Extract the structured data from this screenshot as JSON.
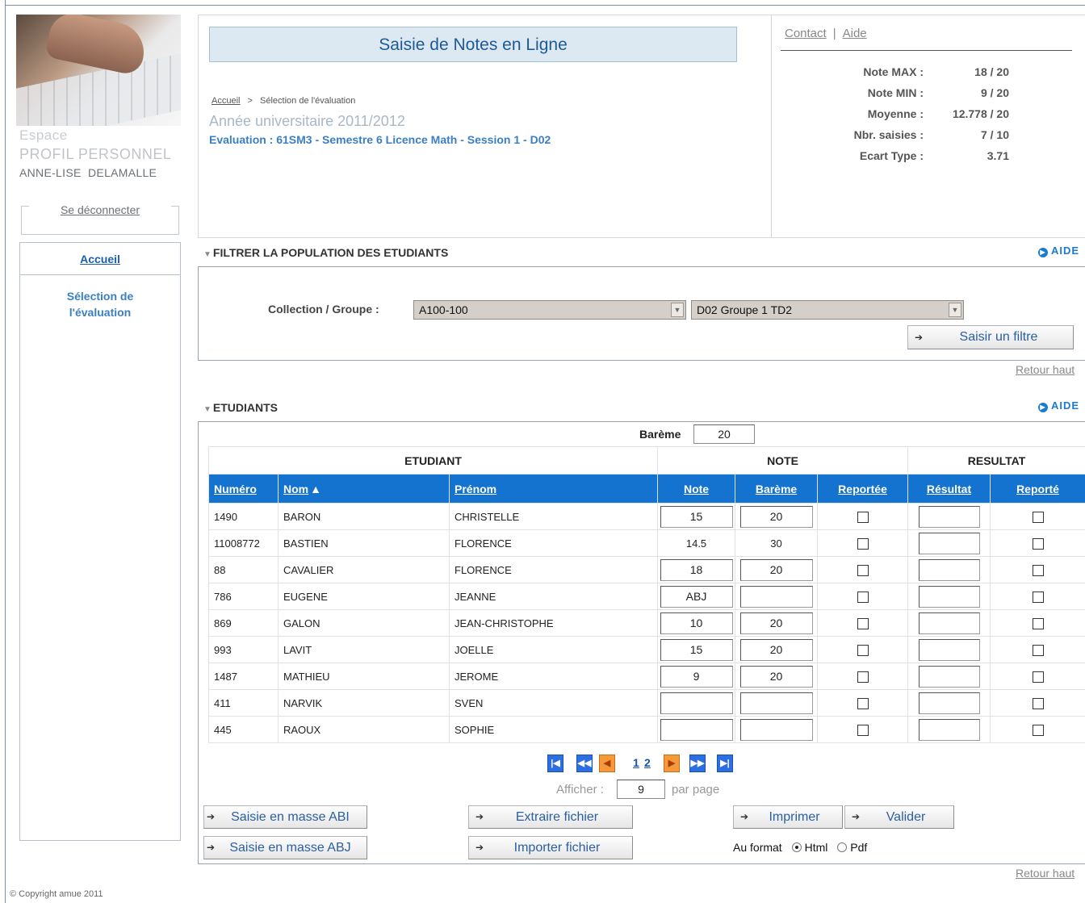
{
  "app": {
    "title": "Saisie de Notes en Ligne",
    "copyright": "© Copyright amue 2011"
  },
  "profile": {
    "espace": "Espace",
    "profil": "PROFIL PERSONNEL",
    "user_first": "ANNE-LISE",
    "user_last": "DELAMALLE",
    "logout": "Se déconnecter"
  },
  "nav": {
    "home": "Accueil",
    "selection_line1": "Sélection de",
    "selection_line2": "l'évaluation"
  },
  "header": {
    "breadcrumb_home": "Accueil",
    "breadcrumb_sep": ">",
    "breadcrumb_current": "Sélection de l'évaluation",
    "year": "Année universitaire 2011/2012",
    "evaluation": "Evaluation : 61SM3 - Semestre 6 Licence Math - Session 1 - D02"
  },
  "toplinks": {
    "contact": "Contact",
    "sep": "|",
    "aide": "Aide"
  },
  "stats": [
    {
      "label": "Note MAX :",
      "value": "18 / 20"
    },
    {
      "label": "Note MIN :",
      "value": "9 / 20"
    },
    {
      "label": "Moyenne :",
      "value": "12.778 / 20"
    },
    {
      "label": "Nbr. saisies :",
      "value": "7 / 10"
    },
    {
      "label": "Ecart Type :",
      "value": "3.71"
    }
  ],
  "filter": {
    "heading": "FILTRER LA POPULATION DES ETUDIANTS",
    "aide": "AIDE",
    "collection_label": "Collection / Groupe :",
    "collection_value": "A100-100",
    "groupe_value": "D02 Groupe 1 TD2",
    "filter_button": "Saisir un filtre",
    "retour": "Retour haut"
  },
  "students": {
    "heading": "ETUDIANTS",
    "aide": "AIDE",
    "bareme_label": "Barème",
    "bareme_value": "20",
    "groups": {
      "etudiant": "ETUDIANT",
      "note": "NOTE",
      "resultat": "RESULTAT"
    },
    "columns": {
      "numero": "Numéro",
      "nom": "Nom",
      "sort_indicator": "▲",
      "prenom": "Prénom",
      "note": "Note",
      "bareme": "Barème",
      "reportee": "Reportée",
      "resultat": "Résultat",
      "reporte": "Reporté"
    },
    "rows": [
      {
        "numero": "1490",
        "nom": "BARON",
        "prenom": "CHRISTELLE",
        "note": "15",
        "bareme": "20",
        "editable": true
      },
      {
        "numero": "11008772",
        "nom": "BASTIEN",
        "prenom": "FLORENCE",
        "note": "14.5",
        "bareme": "30",
        "editable": false
      },
      {
        "numero": "88",
        "nom": "CAVALIER",
        "prenom": "FLORENCE",
        "note": "18",
        "bareme": "20",
        "editable": true
      },
      {
        "numero": "786",
        "nom": "EUGENE",
        "prenom": "JEANNE",
        "note": "ABJ",
        "bareme": "",
        "editable": true
      },
      {
        "numero": "869",
        "nom": "GALON",
        "prenom": "JEAN-CHRISTOPHE",
        "note": "10",
        "bareme": "20",
        "editable": true
      },
      {
        "numero": "993",
        "nom": "LAVIT",
        "prenom": "JOELLE",
        "note": "15",
        "bareme": "20",
        "editable": true
      },
      {
        "numero": "1487",
        "nom": "MATHIEU",
        "prenom": "JEROME",
        "note": "9",
        "bareme": "20",
        "editable": true
      },
      {
        "numero": "411",
        "nom": "NARVIK",
        "prenom": "SVEN",
        "note": "",
        "bareme": "",
        "editable": true
      },
      {
        "numero": "445",
        "nom": "RAOUX",
        "prenom": "SOPHIE",
        "note": "",
        "bareme": "",
        "editable": true
      }
    ],
    "pager": {
      "page1": "1",
      "page2": "2",
      "first": "|◀",
      "prev_block": "◀◀",
      "prev": "◀",
      "next": "▶",
      "next_block": "▶▶",
      "last": "▶|"
    },
    "afficher_label": "Afficher :",
    "afficher_value": "9",
    "par_page": "par page",
    "buttons": {
      "masse_abi": "Saisie en masse ABI",
      "masse_abj": "Saisie en masse ABJ",
      "extraire": "Extraire fichier",
      "importer": "Importer fichier",
      "imprimer": "Imprimer",
      "valider": "Valider"
    },
    "format_label": "Au format",
    "format_html": "Html",
    "format_pdf": "Pdf",
    "retour": "Retour haut"
  }
}
